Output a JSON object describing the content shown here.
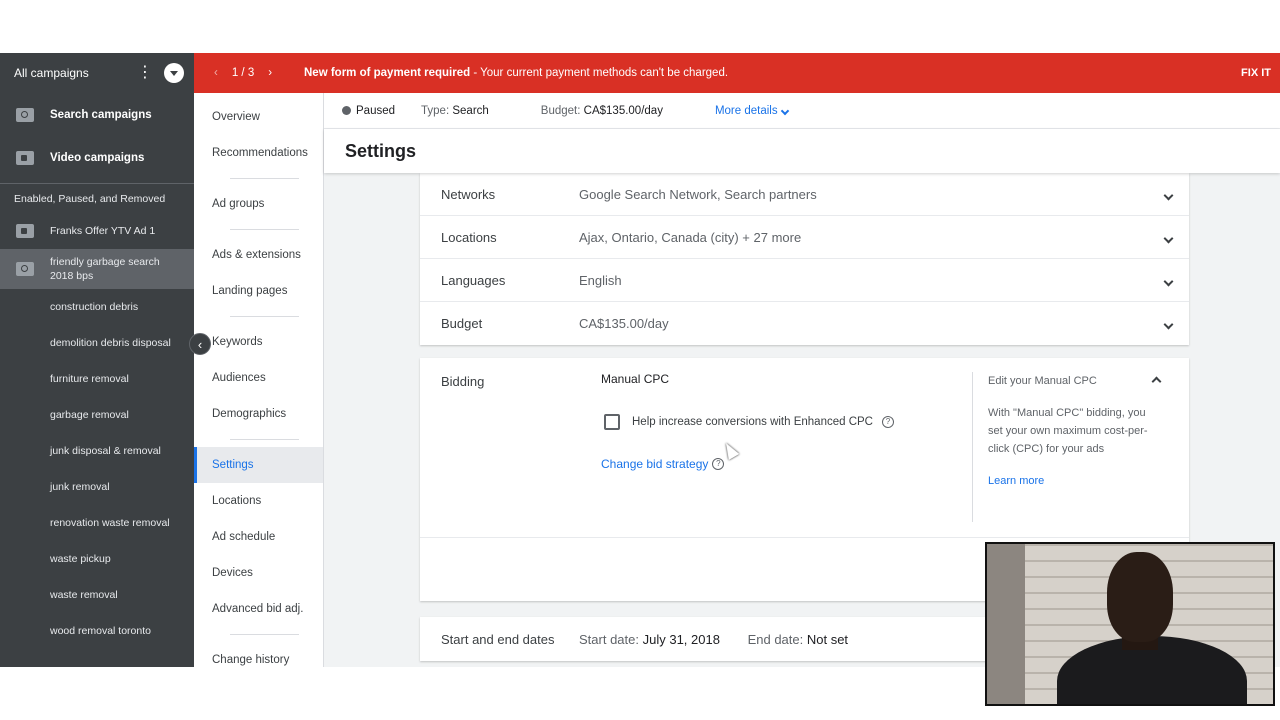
{
  "sidebar": {
    "header": "All campaigns",
    "top_items": [
      {
        "label": "Search campaigns",
        "icon": "search-icon"
      },
      {
        "label": "Video campaigns",
        "icon": "video-icon"
      }
    ],
    "section_label": "Enabled, Paused, and Removed",
    "campaigns": [
      {
        "label": "Franks Offer YTV Ad 1",
        "icon": "video-icon"
      },
      {
        "label": "friendly garbage search 2018 bps",
        "icon": "search-icon"
      }
    ],
    "ad_groups": [
      "construction debris",
      "demolition debris disposal",
      "furniture removal",
      "garbage removal",
      "junk disposal & removal",
      "junk removal",
      "renovation waste removal",
      "waste pickup",
      "waste removal",
      "wood removal toronto"
    ]
  },
  "banner": {
    "counter": "1 / 3",
    "message_bold": "New form of payment required",
    "message_rest": " - Your current payment methods can't be charged.",
    "action": "FIX IT",
    "color": "#d93025"
  },
  "pagenav": {
    "items": [
      "Overview",
      "Recommendations",
      "Ad groups",
      "Ads & extensions",
      "Landing pages",
      "Keywords",
      "Audiences",
      "Demographics",
      "Settings",
      "Locations",
      "Ad schedule",
      "Devices",
      "Advanced bid adj.",
      "Change history"
    ],
    "active": "Settings"
  },
  "summary": {
    "status": "Paused",
    "type_label": "Type:",
    "type_value": "Search",
    "budget_label": "Budget:",
    "budget_value": "CA$135.00/day",
    "more_details": "More details"
  },
  "page_title": "Settings",
  "settings_rows": [
    {
      "label": "Networks",
      "value": "Google Search Network, Search partners"
    },
    {
      "label": "Locations",
      "value": "Ajax, Ontario, Canada (city) + 27 more"
    },
    {
      "label": "Languages",
      "value": "English"
    },
    {
      "label": "Budget",
      "value": "CA$135.00/day"
    }
  ],
  "bidding": {
    "label": "Bidding",
    "strategy": "Manual CPC",
    "enhanced_cpc_label": "Help increase conversions with Enhanced CPC",
    "enhanced_cpc_checked": false,
    "change_link": "Change bid strategy",
    "side_title": "Edit your Manual CPC",
    "side_text": "With \"Manual CPC\" bidding, you set your own maximum cost-per-click (CPC) for your ads",
    "learn_more": "Learn more"
  },
  "dates": {
    "label": "Start and end dates",
    "start_label": "Start date:",
    "start_value": "July 31, 2018",
    "end_label": "End date:",
    "end_value": "Not set"
  },
  "colors": {
    "accent": "#1a73e8",
    "sidebar_bg": "#3c4043"
  }
}
